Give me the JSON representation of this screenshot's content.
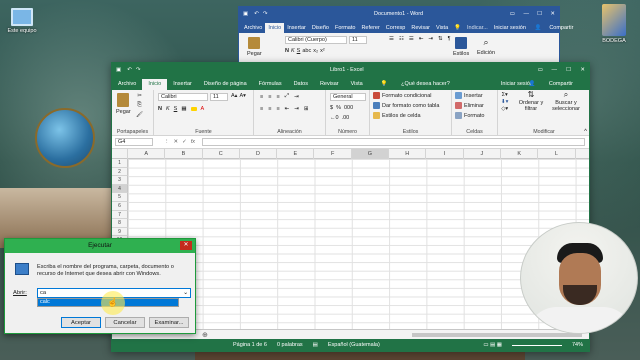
{
  "desktop": {
    "icons": [
      {
        "label": "Este equipo",
        "icon": "computer-icon"
      },
      {
        "label": "BODEGA",
        "icon": "folder-icon"
      }
    ]
  },
  "word": {
    "title": "Documento1 - Word",
    "tabs": [
      "Archivo",
      "Inicio",
      "Insertar",
      "Diseño",
      "Formato",
      "Referer",
      "Corresp",
      "Revisar",
      "Vista"
    ],
    "active_tab": "Inicio",
    "search": "Indicar...",
    "signin": "Iniciar sesión",
    "share": "Compartir",
    "font": "Calibri (Cuerpo)",
    "size": "11",
    "paste": "Pegar",
    "styles": "Estilos",
    "edit": "Edición"
  },
  "excel": {
    "title": "Libro1 - Excel",
    "tabs": [
      "Archivo",
      "Inicio",
      "Insertar",
      "Diseño de página",
      "Fórmulas",
      "Datos",
      "Revisar",
      "Vista"
    ],
    "active_tab": "Inicio",
    "tell_me": "¿Qué desea hacer?",
    "signin": "Iniciar sesión",
    "share": "Compartir",
    "paste": "Pegar",
    "font": "Calibri",
    "size": "11",
    "number_format": "General",
    "groups": [
      "Portapapeles",
      "Fuente",
      "Alineación",
      "Número",
      "Estilos",
      "Celdas",
      "Modificar"
    ],
    "styles_items": [
      "Formato condicional",
      "Dar formato como tabla",
      "Estilos de celda"
    ],
    "cells_items": [
      "Insertar",
      "Eliminar",
      "Formato"
    ],
    "modify_items": [
      "Ordenar y filtrar",
      "Buscar y seleccionar"
    ],
    "name_box": "G4",
    "columns": [
      "A",
      "B",
      "C",
      "D",
      "E",
      "F",
      "G",
      "H",
      "I",
      "J",
      "K",
      "L"
    ],
    "rows": [
      "1",
      "2",
      "3",
      "4",
      "5",
      "6",
      "7",
      "8",
      "9",
      "10",
      "11",
      "12",
      "13",
      "14",
      "15",
      "16",
      "17",
      "18",
      "19",
      "20"
    ],
    "status": [
      "Página 1 de 6",
      "0 palabras",
      "Español (Guatemala)"
    ],
    "zoom": "74%"
  },
  "run": {
    "title": "Ejecutar",
    "description": "Escriba el nombre del programa, carpeta, documento o recurso de Internet que desea abrir con Windows.",
    "open_label": "Abrir:",
    "value": "ca",
    "suggestion": "calc",
    "ok": "Aceptar",
    "cancel": "Cancelar",
    "browse": "Examinar..."
  },
  "colors": {
    "excel_green": "#217346",
    "word_blue": "#2b579a",
    "run_title": "#2fb050"
  }
}
